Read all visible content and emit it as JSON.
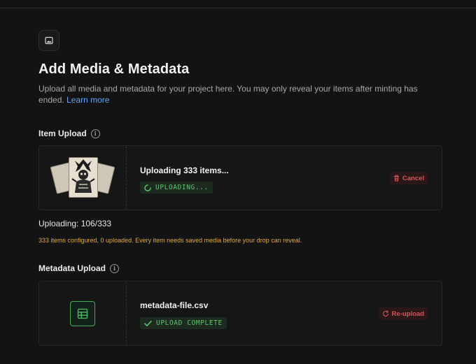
{
  "header": {
    "title": "Add Media & Metadata",
    "description": "Upload all media and metadata for your project here. You may only reveal your items after minting has ended.",
    "learn_more": "Learn more",
    "icon": "image-icon"
  },
  "item_upload": {
    "label": "Item Upload",
    "info_icon": "info-icon",
    "file_name": "Uploading 333 items...",
    "status": "UPLOADING...",
    "status_icon": "spinner-icon",
    "action_label": "Cancel",
    "action_icon": "trash-icon",
    "progress_text": "Uploading: 106/333",
    "progress": {
      "uploaded": 106,
      "total": 333
    },
    "warning": "333 items configured, 0 uploaded. Every item needs saved media before your drop can reveal."
  },
  "metadata_upload": {
    "label": "Metadata Upload",
    "info_icon": "info-icon",
    "file_name": "metadata-file.csv",
    "status": "UPLOAD COMPLETE",
    "status_icon": "check-icon",
    "action_label": "Re-upload",
    "action_icon": "refresh-icon",
    "file_icon": "table-file-icon"
  },
  "colors": {
    "background": "#131313",
    "success": "#5bc86e",
    "danger": "#d2575a",
    "warning": "#e2a93e",
    "link": "#5fa4f5"
  }
}
